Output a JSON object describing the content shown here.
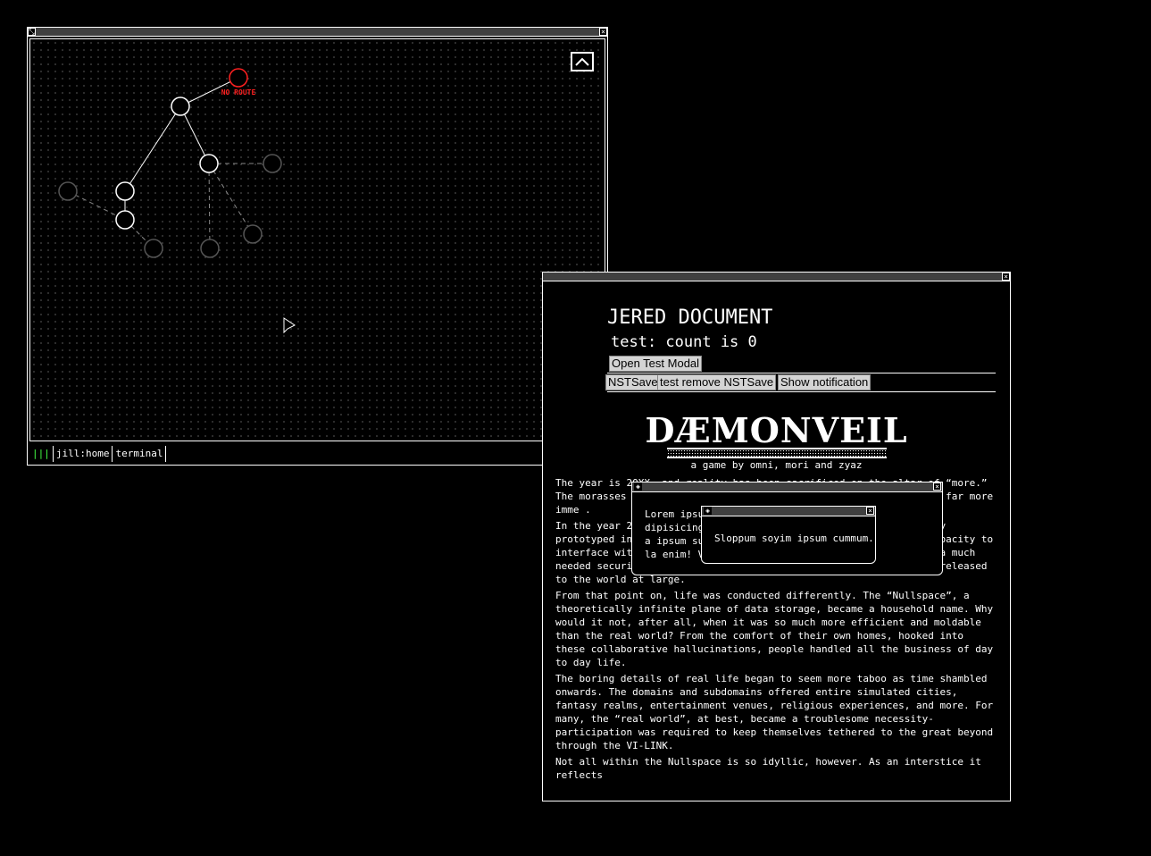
{
  "map_window": {
    "nodes": [
      {
        "id": "n-red",
        "label": "NO ROUTE",
        "status": "no-route"
      },
      {
        "id": "n-top",
        "status": "visited"
      },
      {
        "id": "n-mid",
        "status": "visited"
      },
      {
        "id": "n-left-a",
        "status": "visited"
      },
      {
        "id": "n-left-b",
        "status": "visited"
      },
      {
        "id": "n-far-left",
        "status": "unvisited"
      },
      {
        "id": "n-right",
        "status": "unvisited"
      },
      {
        "id": "n-bottom-1",
        "status": "unvisited"
      },
      {
        "id": "n-bottom-2",
        "status": "unvisited"
      },
      {
        "id": "n-bottom-3",
        "status": "unvisited"
      }
    ],
    "no_route_label": "NO ROUTE",
    "taskbar": {
      "status_icon": "|||",
      "items": [
        "jill:home",
        "terminal"
      ]
    }
  },
  "doc_window": {
    "title": "JERED DOCUMENT",
    "test_count": "test: count is 0",
    "buttons": {
      "open_modal": "Open Test Modal",
      "nst_save": "NSTSave",
      "remove_nst_save": "test remove NSTSave",
      "show_notification": "Show notification"
    },
    "logo": "DÆMONVEIL",
    "byline": "a game by omni, mori and zyaz",
    "paragraphs": [
      "The year is 20XX, and reality has been sacrificed on the altar of “more.” The morasses of t                                                                          a seemingly endl                                                                      ending to promise a futu                                                                    wards far more imme                                                                      .",
      "In the year 20                                                                       chnology technologies c                                                                        e VI-LINK, first officially prototyped in 2012, was the first device ever created with the capacity to interface with the human soul. And in 2013, the VI-LINK received a much needed security patch in the form of the Dæmonveil, before being released to the world at large.",
      "From that point on, life was conducted differently. The “Nullspace”, a theoretically infinite plane of data storage, became a household name. Why would it not, after all, when it was so much more efficient and moldable than the real world? From the comfort of their own homes, hooked into these collaborative hallucinations, people handled all the business of day to day life.",
      "The boring details of real life began to seem more taboo as time shambled onwards. The domains and subdomains offered entire simulated cities, fantasy realms, entertainment venues, religious experiences, and more. For many, the “real world”, at best, became a troublesome necessity- participation was required to keep themselves tethered to the great beyond through the VI-LINK.",
      "Not all within the Nullspace is so idyllic, however. As an interstice it reflects"
    ]
  },
  "modal_outer": {
    "text": "Lorem ipsu                                       dipisicing elit. Numqu                                   a ipsum suscipit an                                   la enim! Velit sed n"
  },
  "modal_inner": {
    "text": "Sloppum soyim ipsum cummum."
  },
  "colors": {
    "background": "#000000",
    "foreground": "#ffffff",
    "no_route": "#ff2020",
    "status_green": "#44ff44"
  }
}
